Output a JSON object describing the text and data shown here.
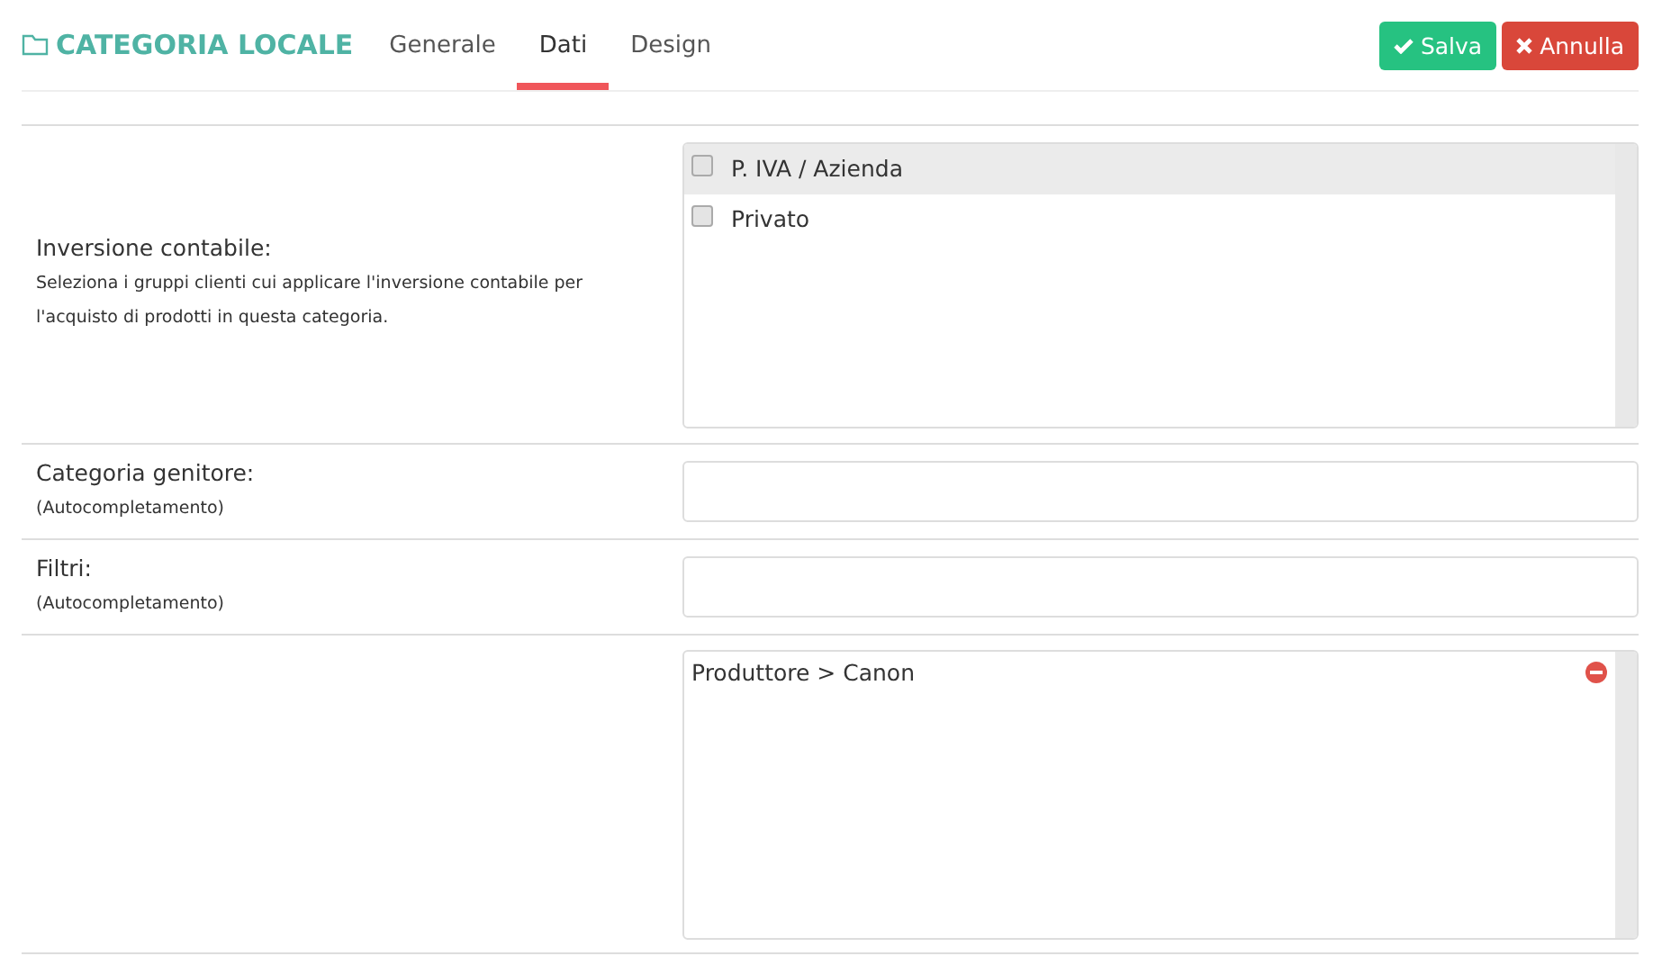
{
  "header": {
    "title": "CATEGORIA LOCALE"
  },
  "tabs": [
    {
      "label": "Generale",
      "selected": false
    },
    {
      "label": "Dati",
      "selected": true
    },
    {
      "label": "Design",
      "selected": false
    }
  ],
  "buttons": [
    {
      "kind": "save",
      "label": "Salva"
    },
    {
      "kind": "cancel",
      "label": "Annulla"
    }
  ],
  "rows": [
    {
      "kind": "checklist",
      "label": "Inversione contabile:",
      "hint": "Seleziona i gruppi clienti cui applicare l'inversione contabile per l'acquisto di prodotti in questa categoria.",
      "options": [
        {
          "label": "P. IVA / Azienda",
          "checked": false,
          "highlighted": true
        },
        {
          "label": "Privato",
          "checked": false,
          "highlighted": false
        }
      ]
    },
    {
      "kind": "input",
      "label": "Categoria genitore:",
      "hint": "(Autocompletamento)"
    },
    {
      "kind": "input",
      "label": "Filtri:",
      "hint": "(Autocompletamento)"
    },
    {
      "kind": "taglist",
      "tags": [
        {
          "label": "Produttore > Canon"
        }
      ]
    }
  ]
}
